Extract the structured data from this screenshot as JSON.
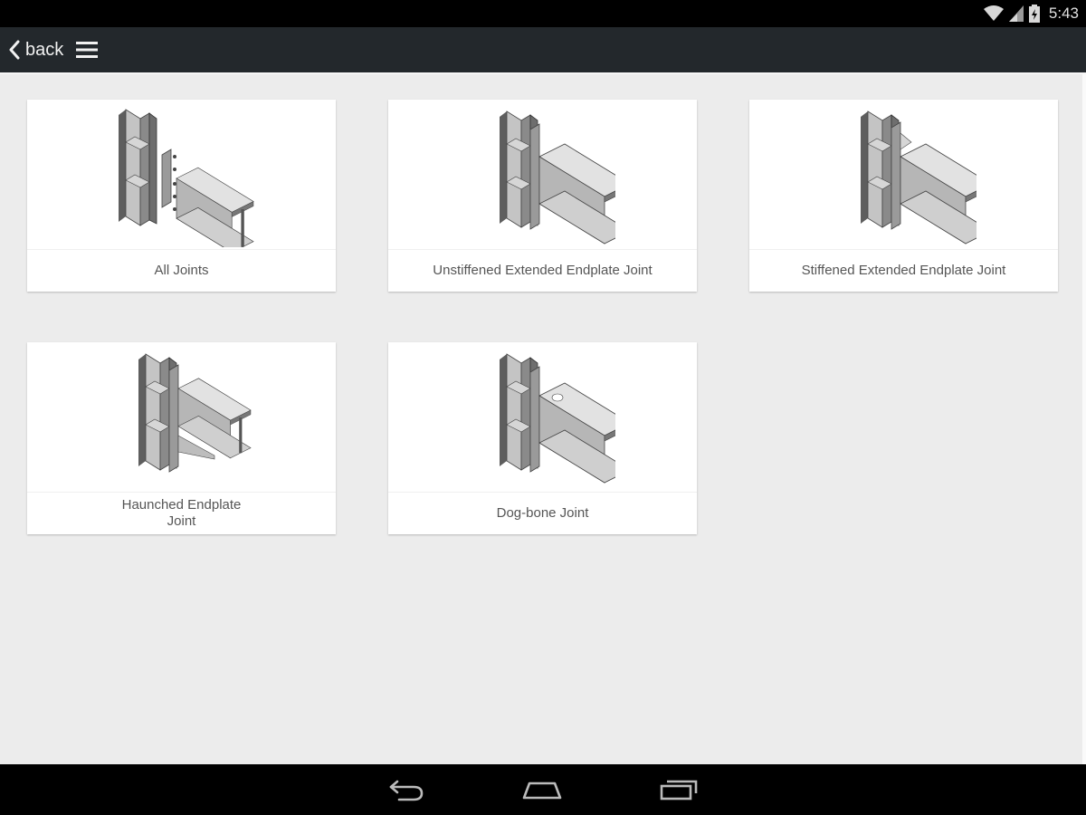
{
  "status": {
    "time": "5:43"
  },
  "appbar": {
    "back_label": "back"
  },
  "cards": [
    {
      "label": "All Joints",
      "icon": "all-joints-diagram"
    },
    {
      "label": "Unstiffened Extended Endplate Joint",
      "icon": "unstiffened-endplate-diagram"
    },
    {
      "label": "Stiffened Extended Endplate Joint",
      "icon": "stiffened-endplate-diagram"
    },
    {
      "label": "Haunched Endplate Joint",
      "icon": "haunched-endplate-diagram"
    },
    {
      "label": "Dog-bone Joint",
      "icon": "dog-bone-diagram"
    }
  ],
  "colors": {
    "status_bar": "#000000",
    "app_bar": "#23282c",
    "background": "#ececec",
    "card": "#ffffff",
    "steel_dark": "#5e5e5e",
    "steel_light": "#bdbdbd"
  }
}
